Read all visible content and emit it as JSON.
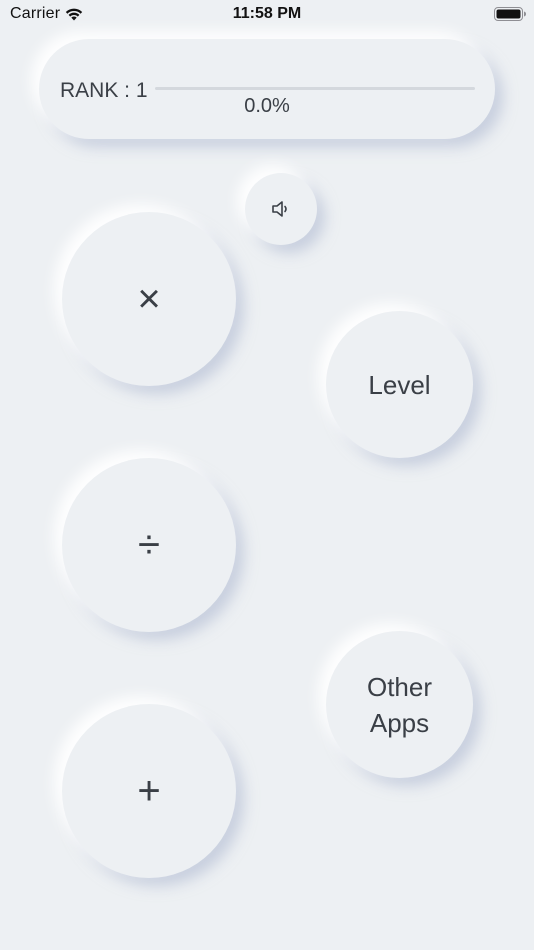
{
  "status_bar": {
    "carrier": "Carrier",
    "time": "11:58 PM",
    "icons": [
      "wifi-icon",
      "battery-icon"
    ]
  },
  "rank": {
    "label": "RANK : 1",
    "progress_text": "0.0%",
    "progress_value": 0.0
  },
  "buttons": {
    "sound_icon": "speaker-icon",
    "multiply": "×",
    "level": "Level",
    "divide": "÷",
    "other_apps": "Other\nApps",
    "plus": "+"
  },
  "colors": {
    "background": "#edf0f3",
    "text": "#3a3f46",
    "track": "#d4d8dd"
  }
}
